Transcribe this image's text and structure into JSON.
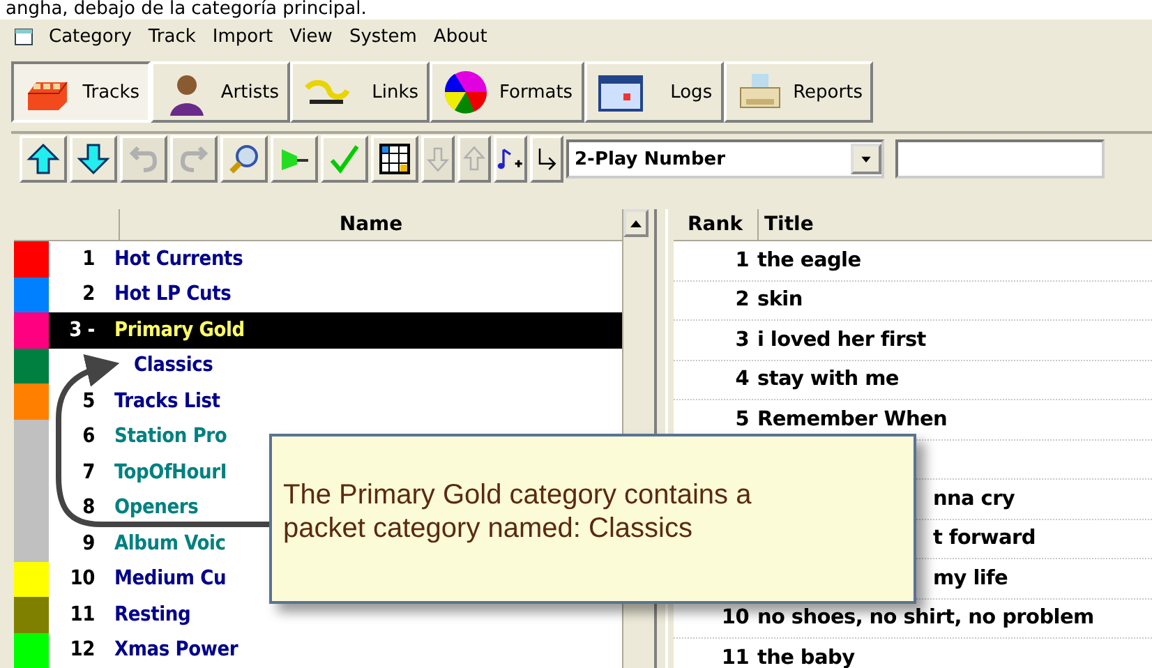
{
  "caption": "angha, debajo de la categoría principal.",
  "menu": [
    "Category",
    "Track",
    "Import",
    "View",
    "System",
    "About"
  ],
  "tabs": [
    {
      "label": "Tracks",
      "selected": true
    },
    {
      "label": "Artists",
      "selected": false
    },
    {
      "label": "Links",
      "selected": false
    },
    {
      "label": "Formats",
      "selected": false
    },
    {
      "label": "Logs",
      "selected": false
    },
    {
      "label": "Reports",
      "selected": false
    }
  ],
  "toolbar": [
    {
      "disabled": false
    },
    {
      "disabled": false
    },
    {
      "disabled": true
    },
    {
      "disabled": true
    },
    {
      "disabled": false
    },
    {
      "disabled": false
    },
    {
      "disabled": false
    },
    {
      "disabled": false
    },
    {
      "disabled": true
    },
    {
      "disabled": true
    },
    {
      "disabled": false
    },
    {
      "disabled": false
    }
  ],
  "sort_select": {
    "value": "2-Play Number"
  },
  "categories": {
    "column": "Name",
    "rows": [
      {
        "number": "1",
        "name": "Hot Currents",
        "color": "#ff0000",
        "kind": "normal",
        "selected": false
      },
      {
        "number": "2",
        "name": "Hot LP Cuts",
        "color": "#0080ff",
        "kind": "normal",
        "selected": false
      },
      {
        "number": "3 -",
        "name": "Primary Gold",
        "color": "#ff0080",
        "kind": "normal",
        "selected": true
      },
      {
        "name": "Classics",
        "color": "#008040",
        "kind": "packet",
        "selected": false
      },
      {
        "number": "5",
        "name": "Tracks List",
        "color": "#ff8000",
        "kind": "normal",
        "selected": false
      },
      {
        "number": "6",
        "name": "Station Pro",
        "color": "#c0c0c0",
        "kind": "teal",
        "selected": false
      },
      {
        "number": "7",
        "name": "TopOfHourI",
        "color": "#c0c0c0",
        "kind": "teal",
        "selected": false
      },
      {
        "number": "8",
        "name": "Openers",
        "color": "#c0c0c0",
        "kind": "teal",
        "selected": false
      },
      {
        "number": "9",
        "name": "Album Voic",
        "color": "#c0c0c0",
        "kind": "teal",
        "selected": false
      },
      {
        "number": "10",
        "name": "Medium Cu",
        "color": "#ffff00",
        "kind": "normal",
        "selected": false
      },
      {
        "number": "11",
        "name": "Resting",
        "color": "#808000",
        "kind": "normal",
        "selected": false
      },
      {
        "number": "12",
        "name": "Xmas Power",
        "color": "#00ff00",
        "kind": "normal",
        "selected": false
      }
    ]
  },
  "tracks": {
    "columns": [
      "Rank",
      "Title"
    ],
    "rows": [
      {
        "rank": "1",
        "title": "the eagle",
        "kind": "full"
      },
      {
        "rank": "2",
        "title": "skin",
        "kind": "full"
      },
      {
        "rank": "3",
        "title": "i loved her first",
        "kind": "full"
      },
      {
        "rank": "4",
        "title": "stay with me",
        "kind": "full"
      },
      {
        "rank": "5",
        "title": "Remember When",
        "kind": "full"
      },
      {
        "kind": "covered"
      },
      {
        "title": "nna cry",
        "kind": "covered"
      },
      {
        "title": "t forward",
        "kind": "covered"
      },
      {
        "title": "my life",
        "kind": "covered"
      },
      {
        "rank": "10",
        "title": "no shoes, no shirt, no problem",
        "kind": "full"
      },
      {
        "rank": "11",
        "title": "the baby",
        "kind": "full"
      }
    ]
  },
  "callout": {
    "text": "The Primary Gold category contains a packet category named: Classics"
  }
}
